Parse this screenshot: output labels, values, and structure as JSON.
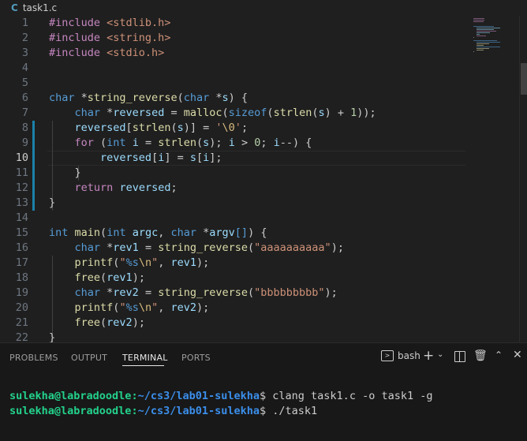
{
  "breadcrumb": {
    "icon": "C",
    "filename": "task1.c"
  },
  "editor": {
    "current_line": 10,
    "lines": [
      {
        "n": "1",
        "tokens": [
          [
            "pre",
            "#include "
          ],
          [
            "str",
            "<stdlib.h>"
          ]
        ]
      },
      {
        "n": "2",
        "tokens": [
          [
            "pre",
            "#include "
          ],
          [
            "str",
            "<string.h>"
          ]
        ]
      },
      {
        "n": "3",
        "tokens": [
          [
            "pre",
            "#include "
          ],
          [
            "str",
            "<stdio.h>"
          ]
        ]
      },
      {
        "n": "4",
        "tokens": []
      },
      {
        "n": "5",
        "tokens": []
      },
      {
        "n": "6",
        "tokens": [
          [
            "type",
            "char"
          ],
          [
            "txt",
            " *"
          ],
          [
            "fn",
            "string_reverse"
          ],
          [
            "txt",
            "("
          ],
          [
            "type",
            "char"
          ],
          [
            "txt",
            " *"
          ],
          [
            "var",
            "s"
          ],
          [
            "txt",
            ") {"
          ]
        ]
      },
      {
        "n": "7",
        "tokens": [
          [
            "txt",
            "    "
          ],
          [
            "type",
            "char"
          ],
          [
            "txt",
            " *"
          ],
          [
            "var",
            "reversed"
          ],
          [
            "txt",
            " = "
          ],
          [
            "fn",
            "malloc"
          ],
          [
            "txt",
            "("
          ],
          [
            "type",
            "sizeof"
          ],
          [
            "txt",
            "("
          ],
          [
            "fn",
            "strlen"
          ],
          [
            "txt",
            "("
          ],
          [
            "var",
            "s"
          ],
          [
            "txt",
            ") + "
          ],
          [
            "num",
            "1"
          ],
          [
            "txt",
            "));"
          ]
        ]
      },
      {
        "n": "8",
        "tokens": [
          [
            "txt",
            "    "
          ],
          [
            "var",
            "reversed"
          ],
          [
            "txt",
            "["
          ],
          [
            "fn",
            "strlen"
          ],
          [
            "txt",
            "("
          ],
          [
            "var",
            "s"
          ],
          [
            "txt",
            ")] = "
          ],
          [
            "str",
            "'"
          ],
          [
            "esc",
            "\\0"
          ],
          [
            "str",
            "'"
          ],
          [
            "txt",
            ";"
          ]
        ]
      },
      {
        "n": "9",
        "tokens": [
          [
            "txt",
            "    "
          ],
          [
            "ctl",
            "for"
          ],
          [
            "txt",
            " ("
          ],
          [
            "type",
            "int"
          ],
          [
            "txt",
            " "
          ],
          [
            "var",
            "i"
          ],
          [
            "txt",
            " = "
          ],
          [
            "fn",
            "strlen"
          ],
          [
            "txt",
            "("
          ],
          [
            "var",
            "s"
          ],
          [
            "txt",
            "); "
          ],
          [
            "var",
            "i"
          ],
          [
            "txt",
            " > "
          ],
          [
            "num",
            "0"
          ],
          [
            "txt",
            "; "
          ],
          [
            "var",
            "i"
          ],
          [
            "txt",
            "--) {"
          ]
        ]
      },
      {
        "n": "10",
        "tokens": [
          [
            "txt",
            "        "
          ],
          [
            "var",
            "reversed"
          ],
          [
            "txt",
            "["
          ],
          [
            "var",
            "i"
          ],
          [
            "txt",
            "] = "
          ],
          [
            "var",
            "s"
          ],
          [
            "txt",
            "["
          ],
          [
            "var",
            "i"
          ],
          [
            "txt",
            "];"
          ]
        ]
      },
      {
        "n": "11",
        "tokens": [
          [
            "txt",
            "    }"
          ]
        ]
      },
      {
        "n": "12",
        "tokens": [
          [
            "txt",
            "    "
          ],
          [
            "ctl",
            "return"
          ],
          [
            "txt",
            " "
          ],
          [
            "var",
            "reversed"
          ],
          [
            "txt",
            ";"
          ]
        ]
      },
      {
        "n": "13",
        "tokens": [
          [
            "txt",
            "}"
          ]
        ]
      },
      {
        "n": "14",
        "tokens": []
      },
      {
        "n": "15",
        "tokens": [
          [
            "type",
            "int"
          ],
          [
            "txt",
            " "
          ],
          [
            "fn",
            "main"
          ],
          [
            "txt",
            "("
          ],
          [
            "type",
            "int"
          ],
          [
            "txt",
            " "
          ],
          [
            "var",
            "argc"
          ],
          [
            "txt",
            ", "
          ],
          [
            "type",
            "char"
          ],
          [
            "txt",
            " *"
          ],
          [
            "var",
            "argv"
          ],
          [
            "type",
            "[]"
          ],
          [
            "txt",
            ") {"
          ]
        ]
      },
      {
        "n": "16",
        "tokens": [
          [
            "txt",
            "    "
          ],
          [
            "type",
            "char"
          ],
          [
            "txt",
            " *"
          ],
          [
            "var",
            "rev1"
          ],
          [
            "txt",
            " = "
          ],
          [
            "fn",
            "string_reverse"
          ],
          [
            "txt",
            "("
          ],
          [
            "str",
            "\"aaaaaaaaaa\""
          ],
          [
            "txt",
            ");"
          ]
        ]
      },
      {
        "n": "17",
        "tokens": [
          [
            "txt",
            "    "
          ],
          [
            "fn",
            "printf"
          ],
          [
            "txt",
            "("
          ],
          [
            "str",
            "\""
          ],
          [
            "type",
            "%s"
          ],
          [
            "esc",
            "\\n"
          ],
          [
            "str",
            "\""
          ],
          [
            "txt",
            ", "
          ],
          [
            "var",
            "rev1"
          ],
          [
            "txt",
            ");"
          ]
        ]
      },
      {
        "n": "18",
        "tokens": [
          [
            "txt",
            "    "
          ],
          [
            "fn",
            "free"
          ],
          [
            "txt",
            "("
          ],
          [
            "var",
            "rev1"
          ],
          [
            "txt",
            ");"
          ]
        ]
      },
      {
        "n": "19",
        "tokens": [
          [
            "txt",
            "    "
          ],
          [
            "type",
            "char"
          ],
          [
            "txt",
            " *"
          ],
          [
            "var",
            "rev2"
          ],
          [
            "txt",
            " = "
          ],
          [
            "fn",
            "string_reverse"
          ],
          [
            "txt",
            "("
          ],
          [
            "str",
            "\"bbbbbbbbb\""
          ],
          [
            "txt",
            ");"
          ]
        ]
      },
      {
        "n": "20",
        "tokens": [
          [
            "txt",
            "    "
          ],
          [
            "fn",
            "printf"
          ],
          [
            "txt",
            "("
          ],
          [
            "str",
            "\""
          ],
          [
            "type",
            "%s"
          ],
          [
            "esc",
            "\\n"
          ],
          [
            "str",
            "\""
          ],
          [
            "txt",
            ", "
          ],
          [
            "var",
            "rev2"
          ],
          [
            "txt",
            ");"
          ]
        ]
      },
      {
        "n": "21",
        "tokens": [
          [
            "txt",
            "    "
          ],
          [
            "fn",
            "free"
          ],
          [
            "txt",
            "("
          ],
          [
            "var",
            "rev2"
          ],
          [
            "txt",
            ");"
          ]
        ]
      },
      {
        "n": "22",
        "tokens": [
          [
            "txt",
            "}"
          ]
        ]
      }
    ]
  },
  "panel": {
    "tabs": [
      "PROBLEMS",
      "OUTPUT",
      "TERMINAL",
      "PORTS"
    ],
    "active_tab": "TERMINAL",
    "shell_label": "bash",
    "icons": [
      "terminal-icon",
      "add-icon",
      "chevron-down-icon",
      "split-icon",
      "trash-icon",
      "chevron-up-icon",
      "close-icon"
    ]
  },
  "terminal": {
    "lines": [
      {
        "user": "sulekha@labradoodle",
        "sep": ":",
        "path": "~/cs3/lab01-sulekha",
        "prompt": "$ ",
        "cmd": "clang task1.c -o task1 -g"
      },
      {
        "user": "sulekha@labradoodle",
        "sep": ":",
        "path": "~/cs3/lab01-sulekha",
        "prompt": "$ ",
        "cmd": "./task1"
      }
    ]
  },
  "colors": {
    "background": "#1f1f1f",
    "panel_background": "#181818",
    "keyword_purple": "#c586c0",
    "type_blue": "#569cd6",
    "string_orange": "#ce9178",
    "function_yellow": "#dcdcaa",
    "variable_lightblue": "#9cdcfe",
    "number_green": "#b5cea8",
    "prompt_green": "#23d18b",
    "path_blue": "#3b8eea"
  }
}
